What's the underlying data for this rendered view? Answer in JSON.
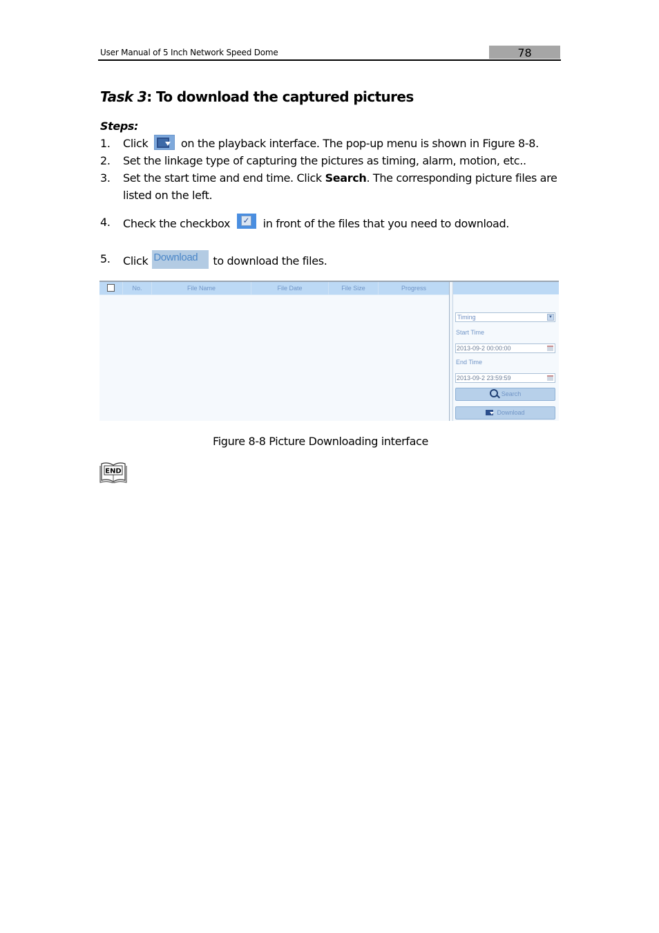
{
  "header": {
    "title": "User Manual of 5 Inch Network Speed Dome",
    "page_number": "78"
  },
  "task": {
    "prefix": "Task 3",
    "title": ": To download the captured pictures"
  },
  "steps_label": "Steps:",
  "steps": [
    {
      "num": "1.",
      "before": "Click",
      "icon": "export-icon",
      "after": "on the playback interface. The pop-up menu is shown in Figure 8-8."
    },
    {
      "num": "2.",
      "text": "Set the linkage type of capturing the pictures as timing, alarm, motion, etc.."
    },
    {
      "num": "3.",
      "before": "Set the start time and end time. Click ",
      "bold": "Search",
      "after": ". The corresponding picture files are",
      "line2": "listed on the left."
    },
    {
      "num": "4.",
      "before": "Check the checkbox",
      "icon": "checkbox-checked-icon",
      "after": "in front of the files that you need to download."
    },
    {
      "num": "5.",
      "before": "Click",
      "button_label": "Download",
      "after": "to download the files."
    }
  ],
  "figure": {
    "table_columns": [
      "No.",
      "File Name",
      "File Date",
      "File Size",
      "Progress"
    ],
    "side_panel": {
      "type_select": "Timing",
      "start_time_label": "Start Time",
      "start_time_value": "2013-09-2 00:00:00",
      "end_time_label": "End Time",
      "end_time_value": "2013-09-2 23:59:59",
      "search_button": "Search",
      "download_button": "Download"
    },
    "caption": "Figure 8-8 Picture Downloading interface"
  },
  "end_icon_label": "END"
}
